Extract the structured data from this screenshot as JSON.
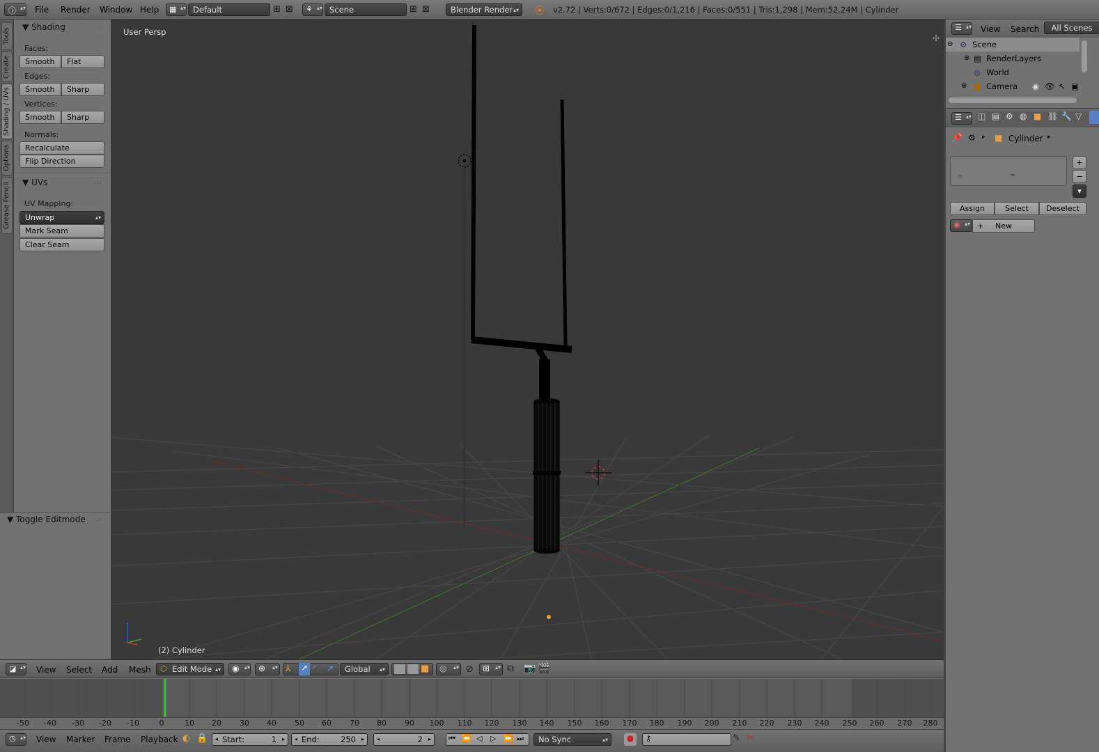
{
  "topbar": {
    "menus": [
      "File",
      "Render",
      "Window",
      "Help"
    ],
    "layout": "Default",
    "scene": "Scene",
    "engine": "Blender Render",
    "info": "v2.72 | Verts:0/672 | Edges:0/1,216 | Faces:0/551 | Tris:1,298 | Mem:52.24M | Cylinder"
  },
  "tabs": [
    "Tools",
    "Create",
    "Shading / UVs",
    "Options",
    "Grease Pencil"
  ],
  "toolpanel": {
    "shading_title": "Shading",
    "faces_label": "Faces:",
    "faces_buttons": [
      "Smooth",
      "Flat"
    ],
    "edges_label": "Edges:",
    "edges_buttons": [
      "Smooth",
      "Sharp"
    ],
    "vertices_label": "Vertices:",
    "vertices_buttons": [
      "Smooth",
      "Sharp"
    ],
    "normals_label": "Normals:",
    "recalculate": "Recalculate",
    "flip_direction": "Flip Direction",
    "uvs_title": "UVs",
    "uv_mapping_label": "UV Mapping:",
    "unwrap": "Unwrap",
    "mark_seam": "Mark Seam",
    "clear_seam": "Clear Seam"
  },
  "lowerpanel": {
    "title": "Toggle Editmode"
  },
  "viewport": {
    "view_label": "User Persp",
    "object_label": "(2) Cylinder"
  },
  "viewheader": {
    "menus": [
      "View",
      "Select",
      "Add",
      "Mesh"
    ],
    "mode": "Edit Mode",
    "orientation": "Global"
  },
  "timeline": {
    "ticks": [
      "-50",
      "-40",
      "-30",
      "-20",
      "-10",
      "0",
      "10",
      "20",
      "30",
      "40",
      "50",
      "60",
      "70",
      "80",
      "90",
      "100",
      "110",
      "120",
      "130",
      "140",
      "150",
      "160",
      "170",
      "180",
      "190",
      "200",
      "210",
      "220",
      "230",
      "240",
      "250",
      "260",
      "270",
      "280"
    ],
    "menus": [
      "View",
      "Marker",
      "Frame",
      "Playback"
    ],
    "start_label": "Start:",
    "start_value": "1",
    "end_label": "End:",
    "end_value": "250",
    "current_frame": "2",
    "sync": "No Sync"
  },
  "outliner": {
    "menus": [
      "View",
      "Search"
    ],
    "filter": "All Scenes",
    "items": [
      "Scene",
      "RenderLayers",
      "World",
      "Camera"
    ]
  },
  "properties": {
    "object": "Cylinder",
    "assign": "Assign",
    "select": "Select",
    "deselect": "Deselect",
    "new": "New"
  }
}
